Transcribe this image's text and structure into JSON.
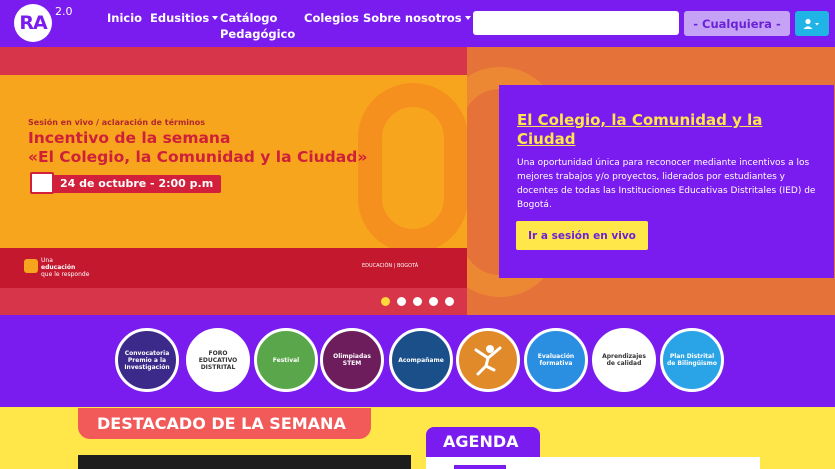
{
  "brand": {
    "logo_text": "RA",
    "version": "2.0"
  },
  "nav": {
    "inicio": "Inicio",
    "edusitios": "Edusitios",
    "catalogo_line1": "Catálogo",
    "catalogo_line2": "Pedagógico",
    "colegios": "Colegios",
    "sobre": "Sobre nosotros"
  },
  "search": {
    "value": "",
    "placeholder": "",
    "filter_label": "- Cualquiera -"
  },
  "colors": {
    "primary": "#7a1cf0",
    "accent_yellow": "#ffe74a",
    "banner_orange": "#f6a51c",
    "banner_red": "#c4182f",
    "destacado_red": "#f25a5a",
    "user_blue": "#1fb3e6"
  },
  "banner": {
    "subtitle": "Sesión en vivo / aclaración de términos",
    "title_line1": "Incentivo de la semana",
    "title_line2": "«El Colegio, la Comunidad y la Ciudad»",
    "date": "24 de octubre - 2:00 p.m",
    "footer_left_line1": "Una",
    "footer_left_line2": "educación",
    "footer_left_line3": "que le responde",
    "footer_right": "EDUCACIÓN | BOGOTÁ"
  },
  "card": {
    "title": "El Colegio, la Comunidad y la Ciudad",
    "description": "Una oportunidad única para reconocer mediante incentivos a los mejores trabajos y/o proyectos, liderados por estudiantes y docentes de todas las Instituciones Educativas Distritales (IED) de Bogotá.",
    "button": "Ir a sesión en vivo"
  },
  "carousel": {
    "slides": 5,
    "active_index": 0
  },
  "circles": [
    {
      "label": "Convocatoria Premio a la Investigación",
      "bg": "#3b2a8a",
      "fg": "#ffffff"
    },
    {
      "label": "FORO EDUCATIVO DISTRITAL",
      "bg": "#ffffff",
      "fg": "#333333"
    },
    {
      "label": "Festival",
      "bg": "#5aa64a",
      "fg": "#ffffff"
    },
    {
      "label": "Olimpiadas STEM",
      "bg": "#6e1d5c",
      "fg": "#ffffff"
    },
    {
      "label": "Acompañame",
      "bg": "#1a4f8a",
      "fg": "#ffffff"
    },
    {
      "label": "",
      "bg": "#e08a2a",
      "fg": "#ffffff"
    },
    {
      "label": "Evaluación formativa",
      "bg": "#2a8fe0",
      "fg": "#ffffff"
    },
    {
      "label": "Aprendizajes de calidad",
      "bg": "#ffffff",
      "fg": "#333333"
    },
    {
      "label": "Plan Distrital de Bilingüismo",
      "bg": "#2aa4e6",
      "fg": "#ffffff"
    }
  ],
  "sections": {
    "destacado": "DESTACADO DE LA SEMANA",
    "agenda": "AGENDA"
  }
}
